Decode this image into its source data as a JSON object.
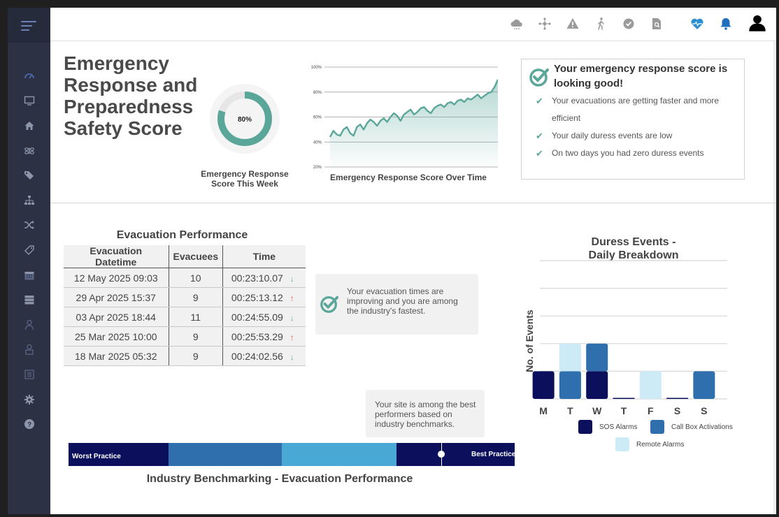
{
  "topbar": {
    "icons": [
      "cloud-icon",
      "network-icon",
      "warning-icon",
      "walking-person-icon",
      "check-circle-icon",
      "document-search-icon",
      "heart-pulse-icon",
      "bell-icon",
      "user-icon"
    ]
  },
  "sidebar": {
    "icons": [
      "speedometer-icon",
      "monitor-icon",
      "home-icon",
      "atom-icon",
      "tags-icon",
      "sitemap-icon",
      "shuffle-icon",
      "tag-icon",
      "calendar-icon",
      "server-icon",
      "person-icon",
      "user-lock-icon",
      "list-icon",
      "gear-icon",
      "help-icon"
    ]
  },
  "header": {
    "title": "Emergency Response and Preparedness Safety Score"
  },
  "score": {
    "percent_label": "80%",
    "value": 0.8,
    "caption": "Emergency Response Score This Week"
  },
  "chart_data": [
    {
      "type": "area",
      "title": "",
      "xlabel": "Emergency Response Score Over Time",
      "ylabel": "",
      "ylim": [
        20,
        100
      ],
      "y_ticks": [
        "100%",
        "80%",
        "60%",
        "40%",
        "20%"
      ],
      "x": [
        0,
        1,
        2,
        3,
        4,
        5,
        6,
        7,
        8,
        9,
        10,
        11,
        12,
        13,
        14,
        15,
        16,
        17,
        18,
        19,
        20,
        21,
        22,
        23,
        24,
        25,
        26,
        27,
        28,
        29,
        30,
        31,
        32,
        33,
        34,
        35,
        36,
        37,
        38,
        39,
        40,
        41,
        42,
        43,
        44,
        45,
        46,
        47,
        48,
        49,
        50
      ],
      "series": [
        {
          "values": [
            44,
            49,
            46,
            45,
            50,
            52,
            47,
            45,
            52,
            54,
            50,
            55,
            58,
            56,
            53,
            57,
            59,
            56,
            60,
            63,
            61,
            57,
            62,
            64,
            66,
            62,
            64,
            67,
            68,
            65,
            63,
            67,
            69,
            70,
            68,
            71,
            72,
            70,
            73,
            74,
            72,
            75,
            74,
            76,
            78,
            75,
            77,
            79,
            80,
            84,
            90
          ]
        }
      ],
      "caption": "Emergency Response Score Over Time"
    },
    {
      "type": "bar",
      "title": "Duress Events - Daily Breakdown",
      "ylabel": "No. of Events",
      "xlabel": "",
      "categories": [
        "M",
        "T",
        "W",
        "T",
        "F",
        "S",
        "S"
      ],
      "ylim": [
        0,
        5
      ],
      "grid": true,
      "legend": "bottom",
      "series": [
        {
          "name": "SOS Alarms",
          "color": "#0b0f5c",
          "values": [
            1,
            0,
            1,
            0,
            0,
            0,
            0
          ]
        },
        {
          "name": "Call Box Activations",
          "color": "#2f6fad",
          "values": [
            0,
            1,
            1,
            0,
            0,
            0,
            1
          ]
        },
        {
          "name": "Remote Alarms",
          "color": "#cdeaf7",
          "values": [
            0,
            1,
            0,
            0,
            1,
            0,
            0
          ]
        }
      ]
    }
  ],
  "summary": {
    "heading": "Your emergency response score is looking good!",
    "items": [
      "Your evacuations are getting faster and more efficient",
      "Your daily duress events are low",
      "On two days you had zero duress events"
    ]
  },
  "evacuation": {
    "title": "Evacuation Performance",
    "columns": [
      "Evacuation Datetime",
      "Evacuees",
      "Time"
    ],
    "rows": [
      {
        "datetime": "12 May 2025 09:03",
        "evacuees": "10",
        "time": "00:23:10.07",
        "trend": "down"
      },
      {
        "datetime": "29 Apr 2025 15:37",
        "evacuees": "9",
        "time": "00:25:13.12",
        "trend": "up"
      },
      {
        "datetime": "03 Apr 2025 18:44",
        "evacuees": "11",
        "time": "00:24:55.09",
        "trend": "down"
      },
      {
        "datetime": "25 Mar 2025 10:00",
        "evacuees": "9",
        "time": "00:25:53.29",
        "trend": "up"
      },
      {
        "datetime": "18 Mar 2025 05:32",
        "evacuees": "9",
        "time": "00:24:02.56",
        "trend": "down"
      }
    ],
    "note": "Your evacuation times are improving and you are among the industry's fastest."
  },
  "benchmark": {
    "note": "Your site is among the best performers based on industry benchmarks.",
    "worst_label": "Worst Practice",
    "best_label": "Best Practice",
    "title": "Industry Benchmarking - Evacuation Performance",
    "segment_colors": [
      "#0b0f5c",
      "#2f6fad",
      "#4aa9d4",
      "#0b0f5c"
    ],
    "site_position": 0.835
  },
  "colors": {
    "accent": "#5aa79a",
    "sidebar": "#2c3244"
  }
}
